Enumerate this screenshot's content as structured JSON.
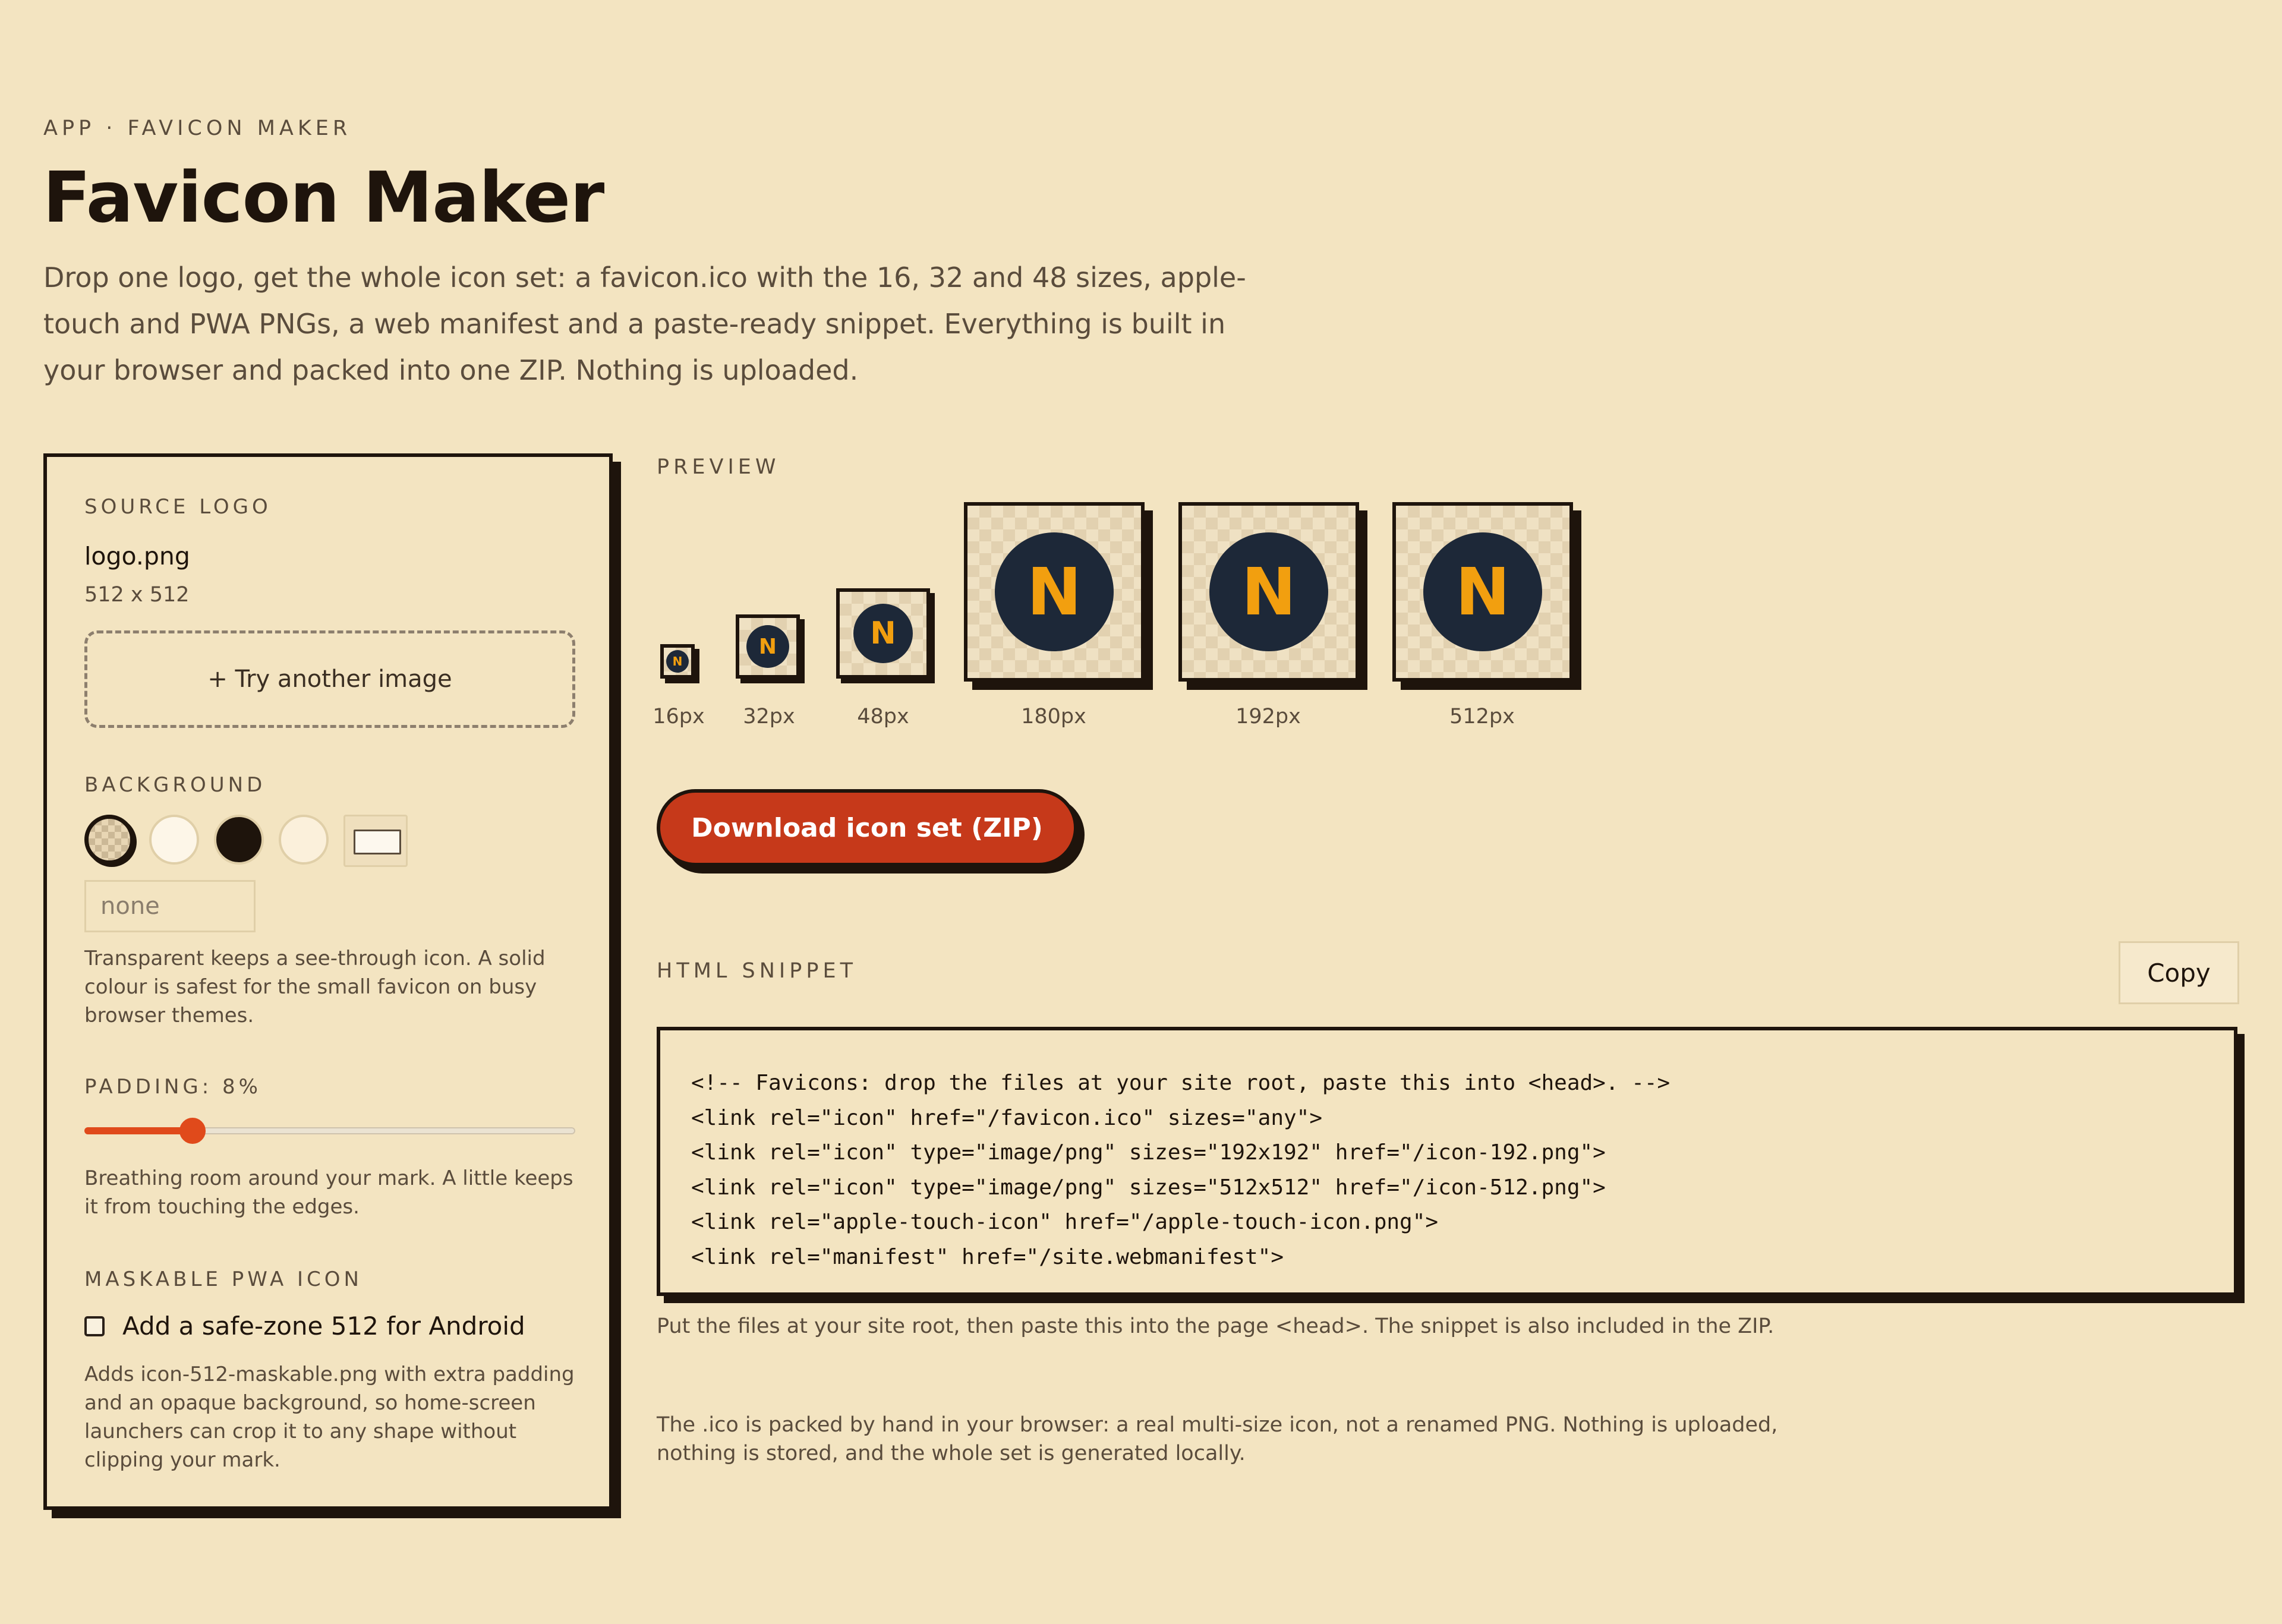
{
  "header": {
    "eyebrow": "APP · FAVICON MAKER",
    "title": "Favicon Maker",
    "intro": "Drop one logo, get the whole icon set: a favicon.ico with the 16, 32 and 48 sizes, apple-touch and PWA PNGs, a web manifest and a paste-ready snippet. Everything is built in your browser and packed into one ZIP. Nothing is uploaded."
  },
  "source": {
    "label": "SOURCE LOGO",
    "filename": "logo.png",
    "dimensions": "512 x 512",
    "try_another": "+ Try another image"
  },
  "background": {
    "label": "BACKGROUND",
    "value": "none",
    "help": "Transparent keeps a see-through icon. A solid colour is safest for the small favicon on busy browser themes.",
    "swatch_colors": [
      "transparent",
      "#fdf6e8",
      "#1e140c",
      "#fbf0db",
      "custom"
    ]
  },
  "padding": {
    "label": "PADDING: 8%",
    "percent": 8,
    "slider_fraction": 0.22,
    "help": "Breathing room around your mark. A little keeps it from touching the edges."
  },
  "maskable": {
    "label": "MASKABLE PWA ICON",
    "checkbox_label": "Add a safe-zone 512 for Android",
    "checked": false,
    "help": "Adds icon-512-maskable.png with extra padding and an opaque background, so home-screen launchers can crop it to any shape without clipping your mark."
  },
  "preview": {
    "label": "PREVIEW",
    "logo_letter": "N",
    "logo_bg_color": "#1d2838",
    "logo_letter_color": "#f29f0f",
    "sizes": [
      {
        "label": "16px"
      },
      {
        "label": "32px"
      },
      {
        "label": "48px"
      },
      {
        "label": "180px"
      },
      {
        "label": "192px"
      },
      {
        "label": "512px"
      }
    ]
  },
  "download": {
    "label": "Download icon set (ZIP)",
    "color": "#c6391a"
  },
  "snippet": {
    "label": "HTML SNIPPET",
    "copy_label": "Copy",
    "lines": [
      "<!-- Favicons: drop the files at your site root, paste this into <head>. -->",
      "<link rel=\"icon\" href=\"/favicon.ico\" sizes=\"any\">",
      "<link rel=\"icon\" type=\"image/png\" sizes=\"192x192\" href=\"/icon-192.png\">",
      "<link rel=\"icon\" type=\"image/png\" sizes=\"512x512\" href=\"/icon-512.png\">",
      "<link rel=\"apple-touch-icon\" href=\"/apple-touch-icon.png\">",
      "<link rel=\"manifest\" href=\"/site.webmanifest\">"
    ],
    "note": "Put the files at your site root, then paste this into the page <head>. The snippet is also included in the ZIP."
  },
  "footer": {
    "text": "The .ico is packed by hand in your browser: a real multi-size icon, not a renamed PNG. Nothing is uploaded, nothing is stored, and the whole set is generated locally."
  }
}
